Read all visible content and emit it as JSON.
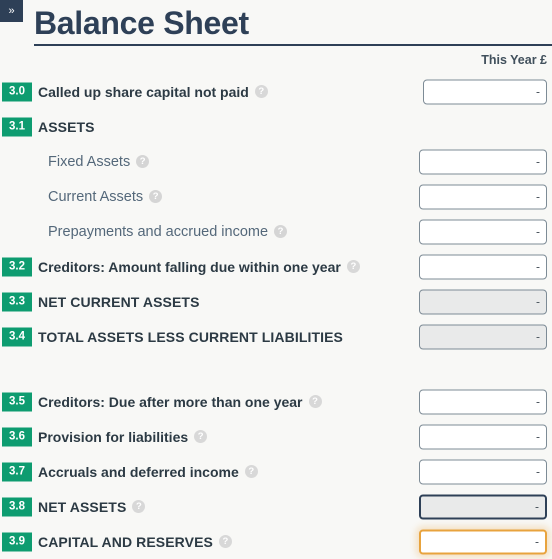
{
  "window": {
    "collapse_toggle_glyph": "»"
  },
  "header": {
    "title": "Balance Sheet"
  },
  "table": {
    "column_header": "This Year £",
    "help_glyph": "?",
    "value_placeholder": "-",
    "rows": [
      {
        "code": "3.0",
        "label": "Called up share capital not paid",
        "has_help": true,
        "style": "normal",
        "value": "-",
        "input_state": "editable",
        "width": "narrow"
      },
      {
        "code": "3.1",
        "label": "ASSETS",
        "has_help": false,
        "style": "section",
        "value": null,
        "input_state": "none"
      },
      {
        "code": "",
        "label": "Fixed Assets",
        "has_help": true,
        "style": "sub",
        "value": "-",
        "input_state": "editable"
      },
      {
        "code": "",
        "label": "Current Assets",
        "has_help": true,
        "style": "sub",
        "value": "-",
        "input_state": "editable"
      },
      {
        "code": "",
        "label": "Prepayments and accrued income",
        "has_help": true,
        "style": "sub",
        "value": "-",
        "input_state": "editable"
      },
      {
        "code": "3.2",
        "label": "Creditors: Amount falling due within one year",
        "has_help": true,
        "style": "normal",
        "value": "-",
        "input_state": "editable"
      },
      {
        "code": "3.3",
        "label": "NET CURRENT ASSETS",
        "has_help": false,
        "style": "caps",
        "value": "-",
        "input_state": "readonly"
      },
      {
        "code": "3.4",
        "label": "TOTAL ASSETS LESS CURRENT LIABILITIES",
        "has_help": false,
        "style": "caps",
        "value": "-",
        "input_state": "readonly"
      },
      {
        "code": "",
        "label": "",
        "has_help": false,
        "style": "spacer",
        "value": null,
        "input_state": "none"
      },
      {
        "code": "3.5",
        "label": "Creditors: Due after more than one year",
        "has_help": true,
        "style": "normal",
        "value": "-",
        "input_state": "editable"
      },
      {
        "code": "3.6",
        "label": "Provision for liabilities",
        "has_help": true,
        "style": "normal",
        "value": "-",
        "input_state": "editable"
      },
      {
        "code": "3.7",
        "label": "Accruals and deferred income",
        "has_help": true,
        "style": "normal",
        "value": "-",
        "input_state": "editable"
      },
      {
        "code": "3.8",
        "label": "NET ASSETS",
        "has_help": true,
        "style": "caps",
        "value": "-",
        "input_state": "total"
      },
      {
        "code": "3.9",
        "label": "CAPITAL AND RESERVES",
        "has_help": true,
        "style": "caps",
        "value": "-",
        "input_state": "focused"
      }
    ]
  },
  "colors": {
    "badge_green": "#0e9c70",
    "header_navy": "#2e4057",
    "focus_orange": "#e8a33d",
    "page_background": "#f8f8f6"
  }
}
